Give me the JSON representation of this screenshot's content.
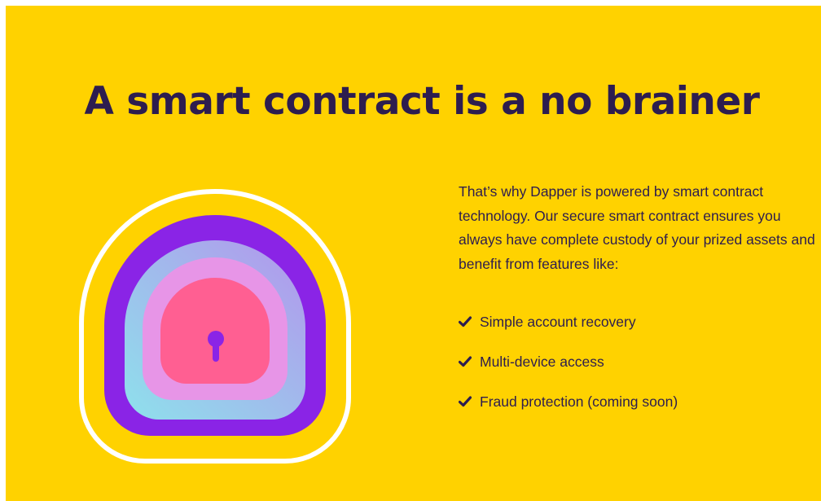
{
  "hero": {
    "title": "A smart contract is a no brainer"
  },
  "description": {
    "text": "That’s why Dapper is powered by smart contract technology. Our secure smart contract ensures you always have complete custody of your prized assets and benefit from features like:"
  },
  "features": [
    {
      "label": "Simple account recovery",
      "icon": "checkmark-icon"
    },
    {
      "label": "Multi-device access",
      "icon": "checkmark-icon"
    },
    {
      "label": "Fraud protection (coming soon)",
      "icon": "checkmark-icon"
    }
  ],
  "illustration": {
    "icon": "padlock-keyhole-icon"
  },
  "colors": {
    "background": "#ffd200",
    "heading": "#2d1d4f",
    "outline": "#ffffff",
    "outer_ring": "#8a24e6",
    "middle_ring_from": "#8ee1ec",
    "middle_ring_to": "#b395ec",
    "inner_ring": "#e795e7",
    "lock_body": "#ff5f92",
    "keyhole": "#8a24e6"
  }
}
